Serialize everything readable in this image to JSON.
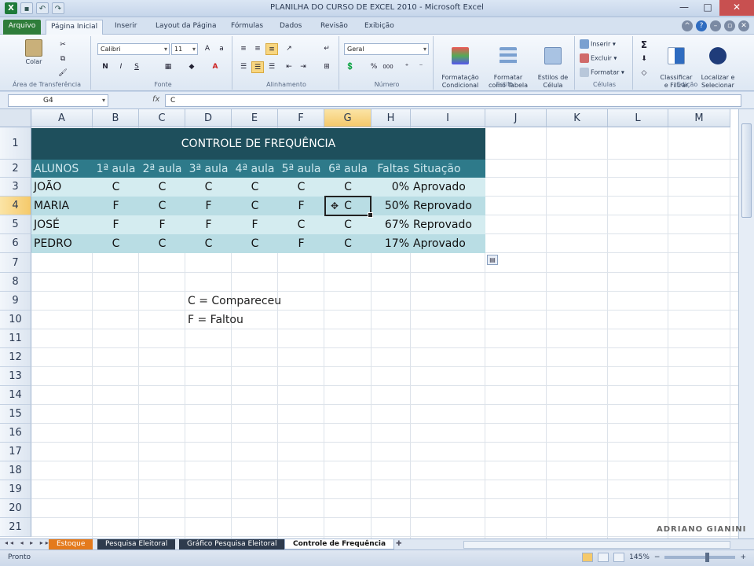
{
  "window": {
    "title": "PLANILHA DO CURSO DE EXCEL 2010 - Microsoft Excel",
    "controls": [
      "—",
      "□",
      "✕"
    ]
  },
  "tabs": [
    "Arquivo",
    "Página Inicial",
    "Inserir",
    "Layout da Página",
    "Fórmulas",
    "Dados",
    "Revisão",
    "Exibição"
  ],
  "ribbon": {
    "clipboard": {
      "label": "Área de Transferência",
      "paste": "Colar"
    },
    "font": {
      "label": "Fonte",
      "name": "Calibri",
      "size": "11",
      "bold": "N",
      "italic": "I",
      "underline": "S"
    },
    "alignment": {
      "label": "Alinhamento"
    },
    "number": {
      "label": "Número",
      "format": "Geral",
      "percent": "%",
      "thousands": "000"
    },
    "styles": {
      "label": "Estilo",
      "conditional": "Formatação\nCondicional",
      "as_table": "Formatar\ncomo Tabela",
      "cell_styles": "Estilos de\nCélula"
    },
    "cells": {
      "label": "Células",
      "insert": "Inserir",
      "delete": "Excluir",
      "format": "Formatar"
    },
    "editing": {
      "label": "Edição",
      "sort": "Classificar\ne Filtrar",
      "find": "Localizar e\nSelecionar",
      "sum": "Σ"
    }
  },
  "formula_bar": {
    "name_box": "G4",
    "fx": "fx",
    "content": "C"
  },
  "columns": [
    "A",
    "B",
    "C",
    "D",
    "E",
    "F",
    "G",
    "H",
    "I",
    "J",
    "K",
    "L",
    "M"
  ],
  "rows": [
    "1",
    "2",
    "3",
    "4",
    "5",
    "6",
    "7",
    "8",
    "9",
    "10",
    "11",
    "12",
    "13",
    "14",
    "15",
    "16",
    "17",
    "18",
    "19",
    "20",
    "21"
  ],
  "sheet": {
    "title": "CONTROLE DE FREQUÊNCIA",
    "headers": [
      "ALUNOS",
      "1ª aula",
      "2ª aula",
      "3ª aula",
      "4ª aula",
      "5ª aula",
      "6ª aula",
      "Faltas",
      "Situação"
    ],
    "students": [
      {
        "name": "JOÃO",
        "classes": [
          "C",
          "C",
          "C",
          "C",
          "C",
          "C"
        ],
        "faltas": "0%",
        "situacao": "Aprovado"
      },
      {
        "name": "MARIA",
        "classes": [
          "F",
          "C",
          "F",
          "C",
          "F",
          "C"
        ],
        "faltas": "50%",
        "situacao": "Reprovado"
      },
      {
        "name": "JOSÉ",
        "classes": [
          "F",
          "F",
          "F",
          "F",
          "C",
          "C"
        ],
        "faltas": "67%",
        "situacao": "Reprovado"
      },
      {
        "name": "PEDRO",
        "classes": [
          "C",
          "C",
          "C",
          "C",
          "F",
          "C"
        ],
        "faltas": "17%",
        "situacao": "Aprovado"
      }
    ],
    "legend": [
      "C = Compareceu",
      "F = Faltou"
    ]
  },
  "sheet_tabs": [
    "Estoque",
    "Pesquisa Eleitoral",
    "Gráfico Pesquisa Eleitoral",
    "Controle de Frequência"
  ],
  "status": {
    "ready": "Pronto",
    "zoom": "145%"
  },
  "watermark": "ADRIANO GIANINI",
  "colors": {
    "title_band": "#1e4f5c",
    "header_band": "#2e7a8a",
    "row_light": "#d4ecf0",
    "row_mid": "#b9dde4",
    "active_tab": "#2f7d3a"
  }
}
